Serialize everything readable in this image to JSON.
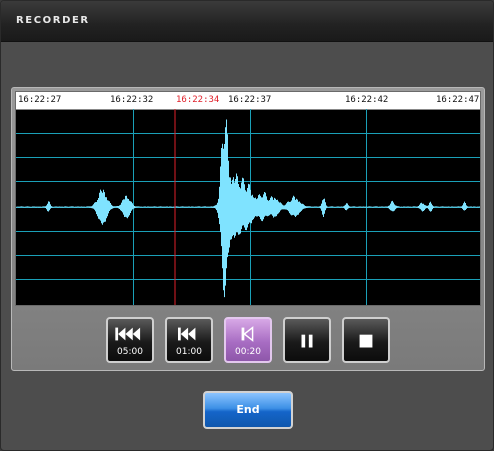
{
  "window": {
    "title": "RECORDER"
  },
  "timeline": {
    "timestamps": [
      "16:22:27",
      "16:22:32",
      "16:22:37",
      "16:22:42",
      "16:22:47"
    ],
    "marker_time": "16:22:34"
  },
  "transport": {
    "buttons": [
      {
        "label": "05:00",
        "icon": "skip-back-triple-icon",
        "active": false
      },
      {
        "label": "01:00",
        "icon": "skip-back-double-icon",
        "active": false
      },
      {
        "label": "00:20",
        "icon": "skip-back-icon",
        "active": true
      },
      {
        "label": "",
        "icon": "pause-icon",
        "active": false
      },
      {
        "label": "",
        "icon": "stop-icon",
        "active": false
      }
    ]
  },
  "actions": {
    "end_label": "End"
  },
  "colors": {
    "waveform": "#7fe3ff",
    "grid": "#1aa0b8",
    "marker": "#e0202a",
    "active_button": "#a86dc3",
    "end_button": "#1f73d6"
  }
}
